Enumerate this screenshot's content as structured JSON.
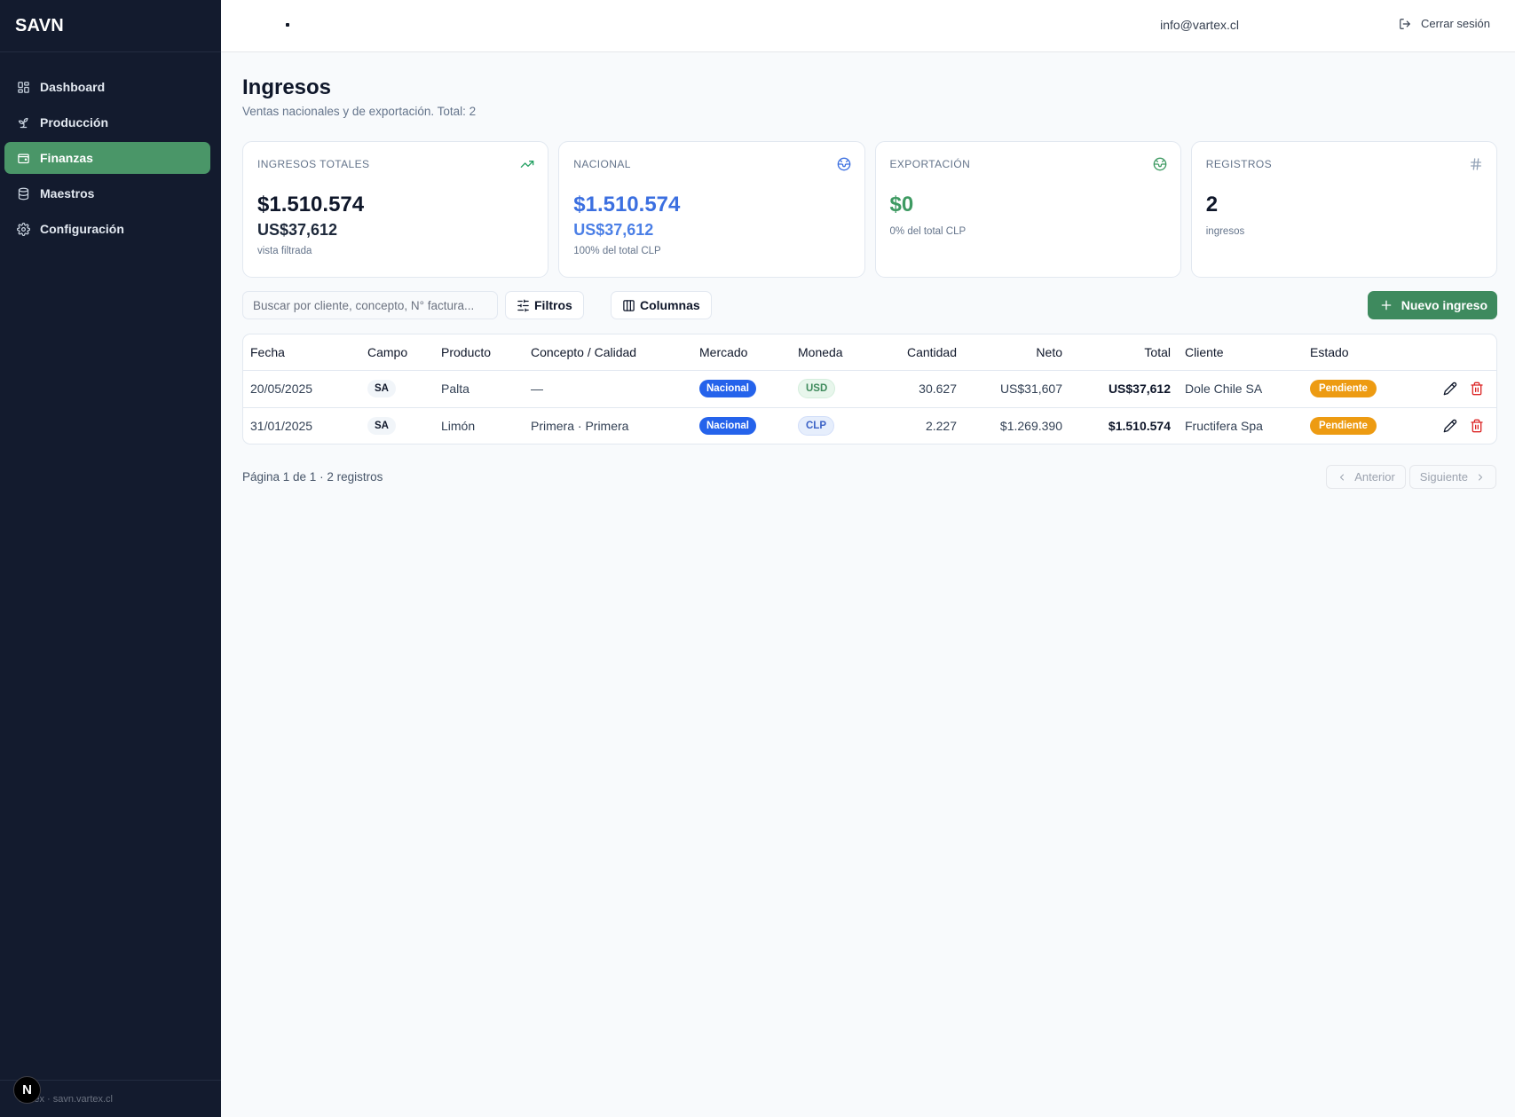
{
  "app": {
    "brand": "SAVN",
    "footer": "Vartex · savn.vartex.cl",
    "n_badge": "N"
  },
  "sidebar": {
    "items": [
      {
        "label": "Dashboard",
        "icon": "dashboard-icon"
      },
      {
        "label": "Producción",
        "icon": "sprout-icon"
      },
      {
        "label": "Finanzas",
        "icon": "wallet-icon",
        "active": true
      },
      {
        "label": "Maestros",
        "icon": "database-icon"
      },
      {
        "label": "Configuración",
        "icon": "gear-icon"
      }
    ]
  },
  "topbar": {
    "user_email": "info@vartex.cl",
    "logout_label": "Cerrar sesión"
  },
  "page": {
    "title": "Ingresos",
    "subtitle": "Ventas nacionales y de exportación. Total: 2"
  },
  "cards": [
    {
      "label": "INGRESOS TOTALES",
      "value": "$1.510.574",
      "sub": "US$37,612",
      "note": "vista filtrada",
      "icon": "trending-up-icon",
      "color": "#0f172a",
      "icon_color": "#22a061"
    },
    {
      "label": "NACIONAL",
      "value": "$1.510.574",
      "sub": "US$37,612",
      "note": "100% del total CLP",
      "icon": "globe-icon",
      "color": "#3b6fe0",
      "icon_color": "#3b6fe0"
    },
    {
      "label": "EXPORTACIÓN",
      "value": "$0",
      "note": "0% del total CLP",
      "icon": "globe-icon",
      "color": "#3e9a62",
      "icon_color": "#3e9a62"
    },
    {
      "label": "REGISTROS",
      "value": "2",
      "note": "ingresos",
      "icon": "hash-icon",
      "color": "#0f172a",
      "icon_color": "#94a3b8"
    }
  ],
  "toolbar": {
    "search_placeholder": "Buscar por cliente, concepto, N° factura...",
    "filters_label": "Filtros",
    "columns_label": "Columnas",
    "new_label": "Nuevo ingreso"
  },
  "table": {
    "columns": [
      "Fecha",
      "Campo",
      "Producto",
      "Concepto / Calidad",
      "Mercado",
      "Moneda",
      "Cantidad",
      "Neto",
      "Total",
      "Cliente",
      "Estado"
    ],
    "rows": [
      {
        "fecha": "20/05/2025",
        "campo": "SA",
        "producto": "Palta",
        "concepto": "—",
        "mercado": "Nacional",
        "moneda": "USD",
        "cantidad": "30.627",
        "neto": "US$31,607",
        "total": "US$37,612",
        "cliente": "Dole Chile SA",
        "estado": "Pendiente"
      },
      {
        "fecha": "31/01/2025",
        "campo": "SA",
        "producto": "Limón",
        "concepto": "Primera · Primera",
        "mercado": "Nacional",
        "moneda": "CLP",
        "cantidad": "2.227",
        "neto": "$1.269.390",
        "total": "$1.510.574",
        "cliente": "Fructifera Spa",
        "estado": "Pendiente"
      }
    ]
  },
  "pagination": {
    "info": "Página 1 de 1 · 2 registros",
    "prev_label": "Anterior",
    "next_label": "Siguiente"
  },
  "colors": {
    "sidebar_bg": "#131b2e",
    "accent_green": "#4a9668",
    "nacional_blue": "#2563eb",
    "pendiente_orange": "#ed9b12",
    "delete_red": "#dc2626"
  }
}
